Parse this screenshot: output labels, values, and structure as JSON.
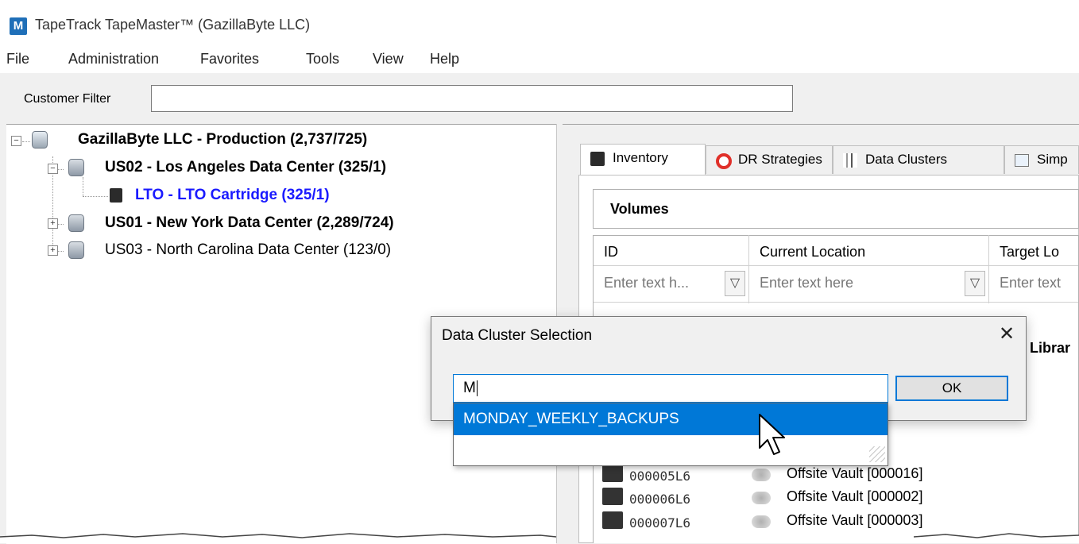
{
  "window": {
    "title": "TapeTrack TapeMaster™ (GazillaByte LLC)",
    "app_icon_letter": "M"
  },
  "menu": [
    "File",
    "Administration",
    "Favorites",
    "Tools",
    "View",
    "Help"
  ],
  "filter": {
    "label": "Customer Filter",
    "value": ""
  },
  "tree": [
    {
      "label": "GazillaByte LLC - Production (2,737/725)",
      "expander": "−",
      "icon": "server-icon"
    },
    {
      "label": "US02 - Los Angeles Data Center (325/1)",
      "expander": "−",
      "icon": "database-icon"
    },
    {
      "label": "LTO - LTO Cartridge (325/1)",
      "icon": "tape-cartridge-icon"
    },
    {
      "label": "US01 - New York Data Center (2,289/724)",
      "expander": "+",
      "icon": "database-icon"
    },
    {
      "label": "US03 - North Carolina Data Center (123/0)",
      "expander": "+",
      "icon": "database-icon"
    }
  ],
  "tabs": [
    {
      "label": "Inventory",
      "icon": "tape-icon"
    },
    {
      "label": "DR Strategies",
      "icon": "lifebuoy-icon"
    },
    {
      "label": "Data Clusters",
      "icon": "bar-chart-icon"
    },
    {
      "label": "Simp",
      "icon": "window-icon"
    }
  ],
  "volumes": {
    "title": "Volumes",
    "columns": [
      "ID",
      "Current Location",
      "Target Lo"
    ],
    "filter_placeholders": [
      "Enter text h...",
      "Enter text here",
      "Enter text"
    ],
    "rows": [
      {
        "id": "000005L6",
        "location": "Offsite Vault [000016]"
      },
      {
        "id": "000006L6",
        "location": "Offsite Vault [000002]"
      },
      {
        "id": "000007L6",
        "location": "Offsite Vault [000003]"
      }
    ],
    "partial_right_text": "Librar"
  },
  "dialog": {
    "title": "Data Cluster Selection",
    "close_glyph": "✕",
    "input_value": "M",
    "ok_label": "OK",
    "suggestion": "MONDAY_WEEKLY_BACKUPS"
  },
  "colors": {
    "accent": "#0078d7",
    "tree_selected": "#1a1aff"
  }
}
